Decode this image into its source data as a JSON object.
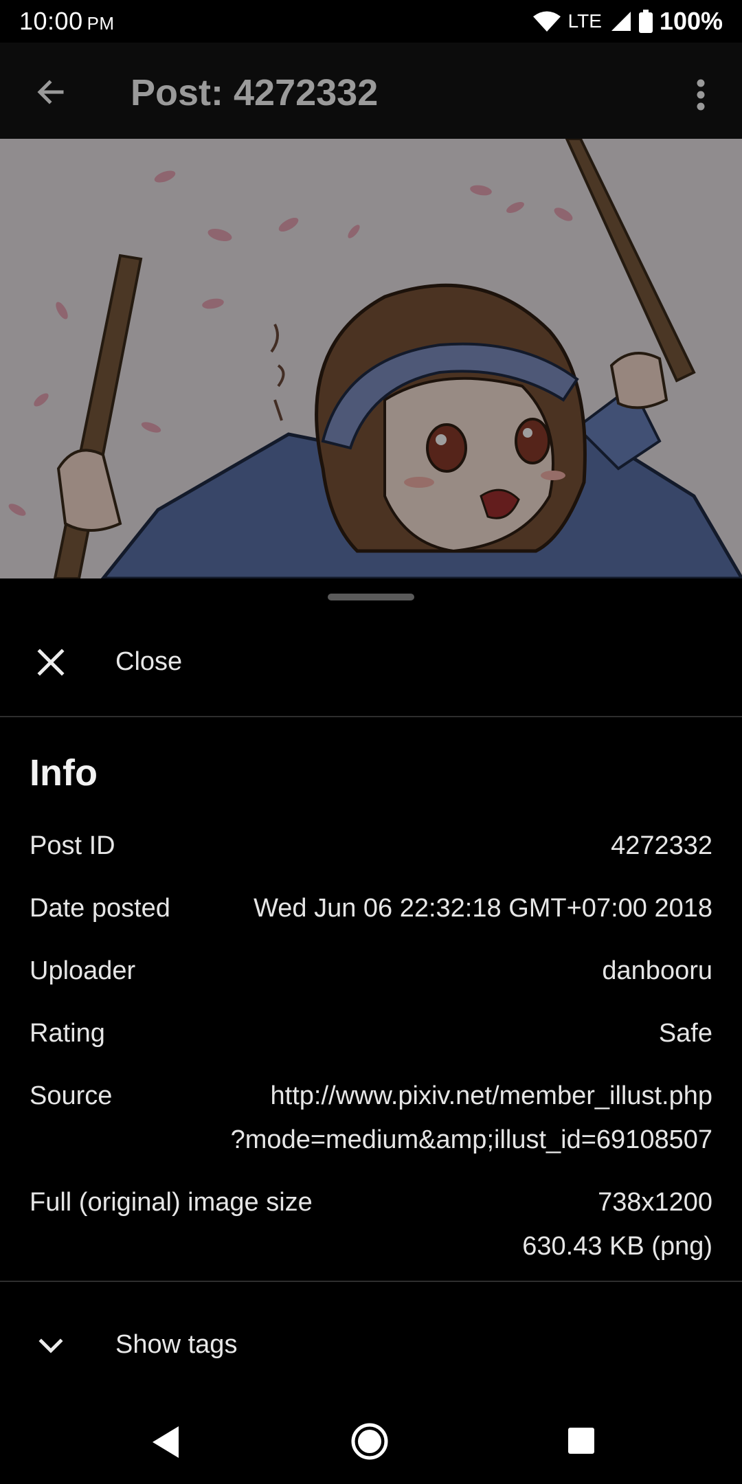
{
  "status_bar": {
    "time": "10:00",
    "ampm": "PM",
    "network": "LTE",
    "battery": "100%"
  },
  "app_bar": {
    "title": "Post: 4272332",
    "icons": [
      "back-arrow-icon",
      "overflow-menu-icon"
    ]
  },
  "sheet": {
    "close_label": "Close",
    "info_heading": "Info",
    "rows": {
      "post_id": {
        "label": "Post ID",
        "value": "4272332"
      },
      "date_posted": {
        "label": "Date posted",
        "value": "Wed Jun 06 22:32:18 GMT+07:00 2018"
      },
      "uploader": {
        "label": "Uploader",
        "value": "danbooru"
      },
      "rating": {
        "label": "Rating",
        "value": "Safe"
      },
      "source": {
        "label": "Source",
        "value_line1": "http://www.pixiv.net/member_illust.php",
        "value_line2": "?mode=medium&amp;illust_id=69108507"
      },
      "size": {
        "label": "Full (original) image size",
        "value_line1": "738x1200",
        "value_line2": "630.43 KB (png)"
      }
    },
    "show_tags_label": "Show tags"
  },
  "nav_bar": {
    "icons": [
      "nav-back-icon",
      "nav-home-icon",
      "nav-recents-icon"
    ]
  },
  "colors": {
    "background": "#000000",
    "app_bar": "#0c0c0c",
    "title_text": "#9a9a9a",
    "divider": "#2e2e2e"
  }
}
